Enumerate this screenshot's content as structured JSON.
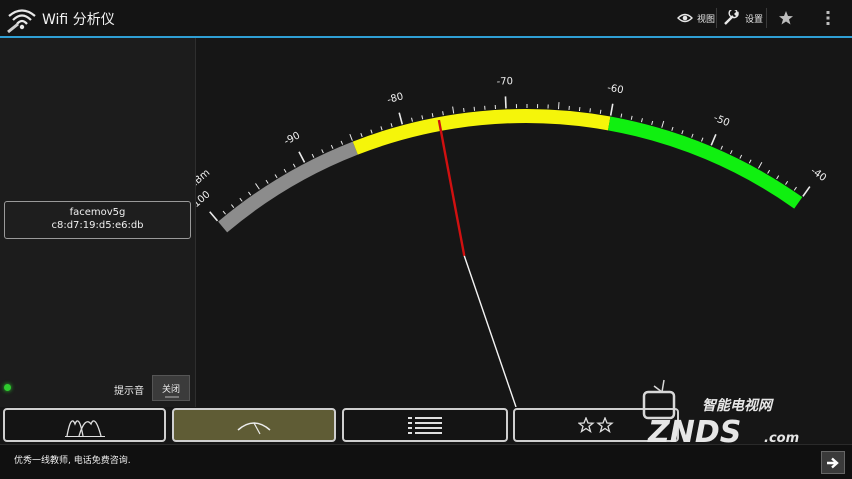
{
  "app": {
    "title": "Wifi 分析仪"
  },
  "actionbar": {
    "view_label": "视图",
    "settings_label": "设置"
  },
  "network": {
    "ssid": "facemov5g",
    "bssid": "c8:d7:19:d5:e6:db",
    "signal_dbm": -76.5
  },
  "sound": {
    "label": "提示音",
    "toggle_label": "关闭"
  },
  "gauge": {
    "unit": "dBm",
    "tick_labels": [
      "-100",
      "-90",
      "-80",
      "-70",
      "-60",
      "-50",
      "-40"
    ],
    "min": -100,
    "max": -40,
    "bands": [
      {
        "from": -100,
        "to": -85,
        "color": "#8c8c8c"
      },
      {
        "from": -85,
        "to": -60,
        "color": "#f5f50a"
      },
      {
        "from": -60,
        "to": -40,
        "color": "#10f010"
      }
    ],
    "needle_color": "#d01010"
  },
  "tabs": [
    {
      "name": "channel-graph",
      "active": false
    },
    {
      "name": "signal-meter",
      "active": true
    },
    {
      "name": "ap-list",
      "active": false
    },
    {
      "name": "channel-rating",
      "active": false
    }
  ],
  "ad": {
    "text": "优秀一线教师, 电话免费咨询."
  },
  "watermark": {
    "brand_cn": "智能电视网",
    "brand": "ZNDS",
    "domain": ".com"
  }
}
